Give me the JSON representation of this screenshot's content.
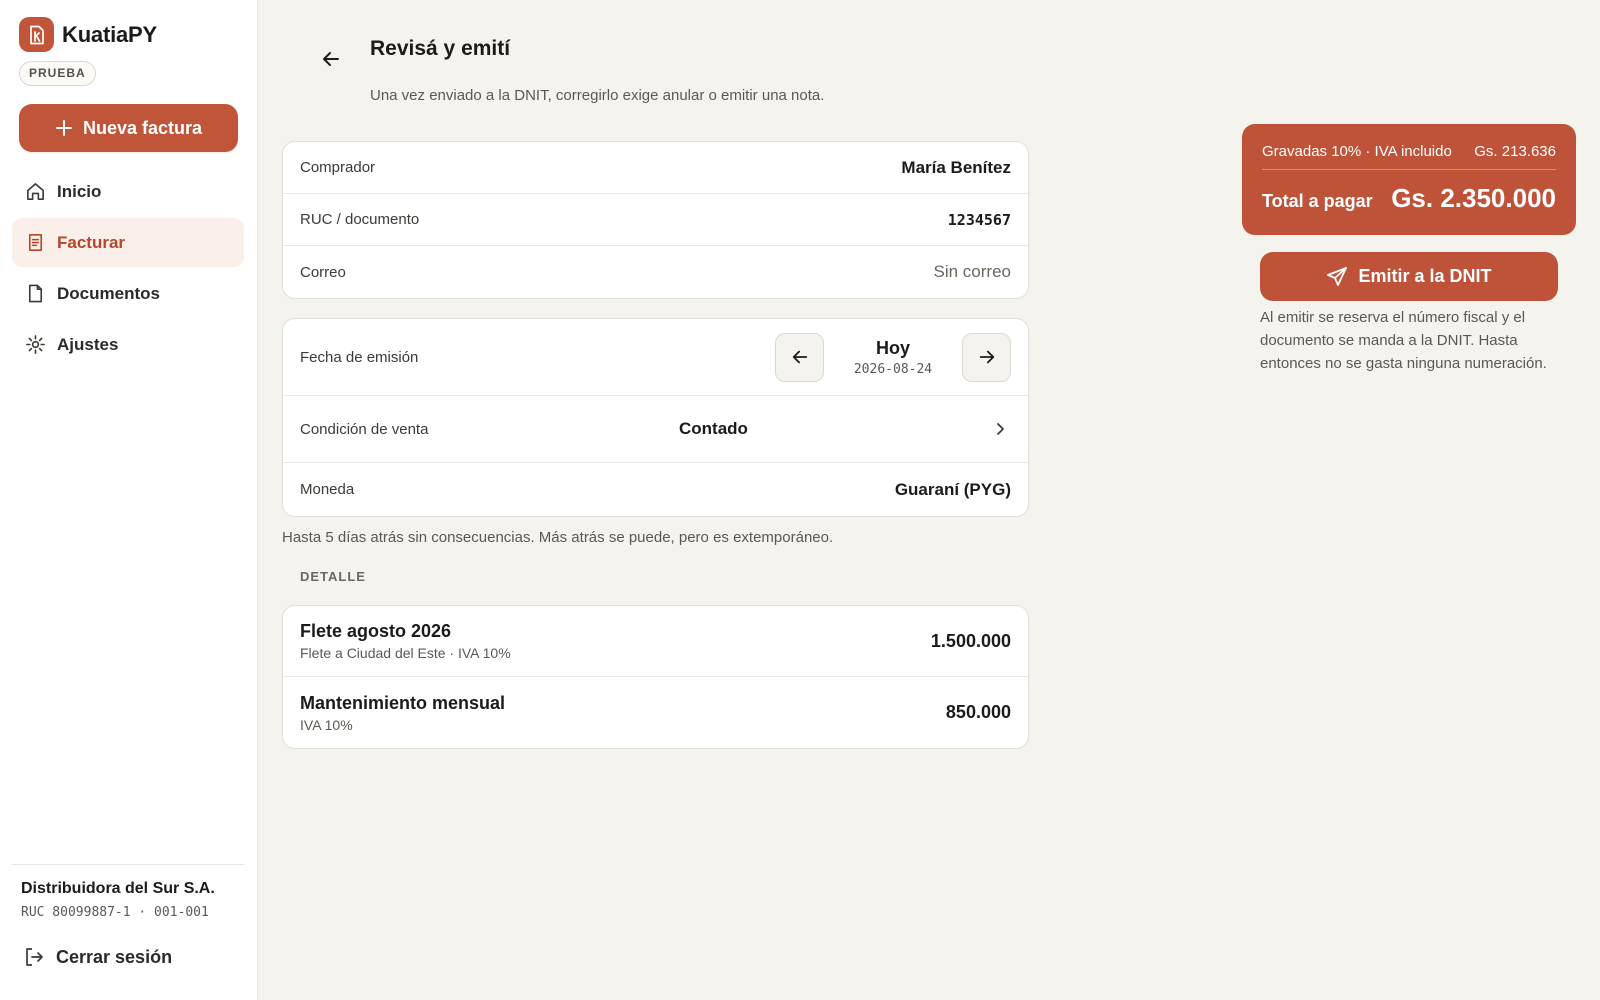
{
  "app": {
    "name": "KuatiaPY",
    "env_badge": "PRUEBA"
  },
  "sidebar": {
    "new_invoice_label": "Nueva factura",
    "items": [
      {
        "label": "Inicio",
        "icon": "home-icon"
      },
      {
        "label": "Facturar",
        "icon": "invoice-icon",
        "active": true
      },
      {
        "label": "Documentos",
        "icon": "document-icon"
      },
      {
        "label": "Ajustes",
        "icon": "gear-icon"
      }
    ],
    "company": {
      "name": "Distribuidora del Sur S.A.",
      "ruc": "RUC 80099887-1 · 001-001"
    },
    "logout_label": "Cerrar sesión"
  },
  "header": {
    "title": "Revisá y emití",
    "subtitle": "Una vez enviado a la DNIT, corregirlo exige anular o emitir una nota."
  },
  "buyer": {
    "buyer_label": "Comprador",
    "buyer_value": "María Benítez",
    "ruc_label": "RUC / documento",
    "ruc_value": "1234567",
    "email_label": "Correo",
    "email_value": "Sin correo"
  },
  "terms": {
    "date_label": "Fecha de emisión",
    "date_main": "Hoy",
    "date_value": "2026-08-24",
    "condition_label": "Condición de venta",
    "condition_value": "Contado",
    "currency_label": "Moneda",
    "currency_value": "Guaraní (PYG)"
  },
  "hint": "Hasta 5 días atrás sin consecuencias. Más atrás se puede, pero es extemporáneo.",
  "detail": {
    "section_label": "DETALLE",
    "items": [
      {
        "title": "Flete agosto 2026",
        "subtitle": "Flete a Ciudad del Este · IVA 10%",
        "amount": "1.500.000"
      },
      {
        "title": "Mantenimiento mensual",
        "subtitle": "IVA 10%",
        "amount": "850.000"
      }
    ]
  },
  "summary": {
    "tax_label": "Gravadas 10% · IVA incluido",
    "tax_value": "Gs. 213.636",
    "total_label": "Total a pagar",
    "total_value": "Gs. 2.350.000",
    "emit_label": "Emitir a la DNIT",
    "emit_note": "Al emitir se reserva el número fiscal y el documento se manda a la DNIT. Hasta entonces no se gasta ninguna numeración."
  },
  "colors": {
    "accent": "#c1553a",
    "background": "#f5f3ee",
    "active_nav_bg": "#fbefe9"
  }
}
